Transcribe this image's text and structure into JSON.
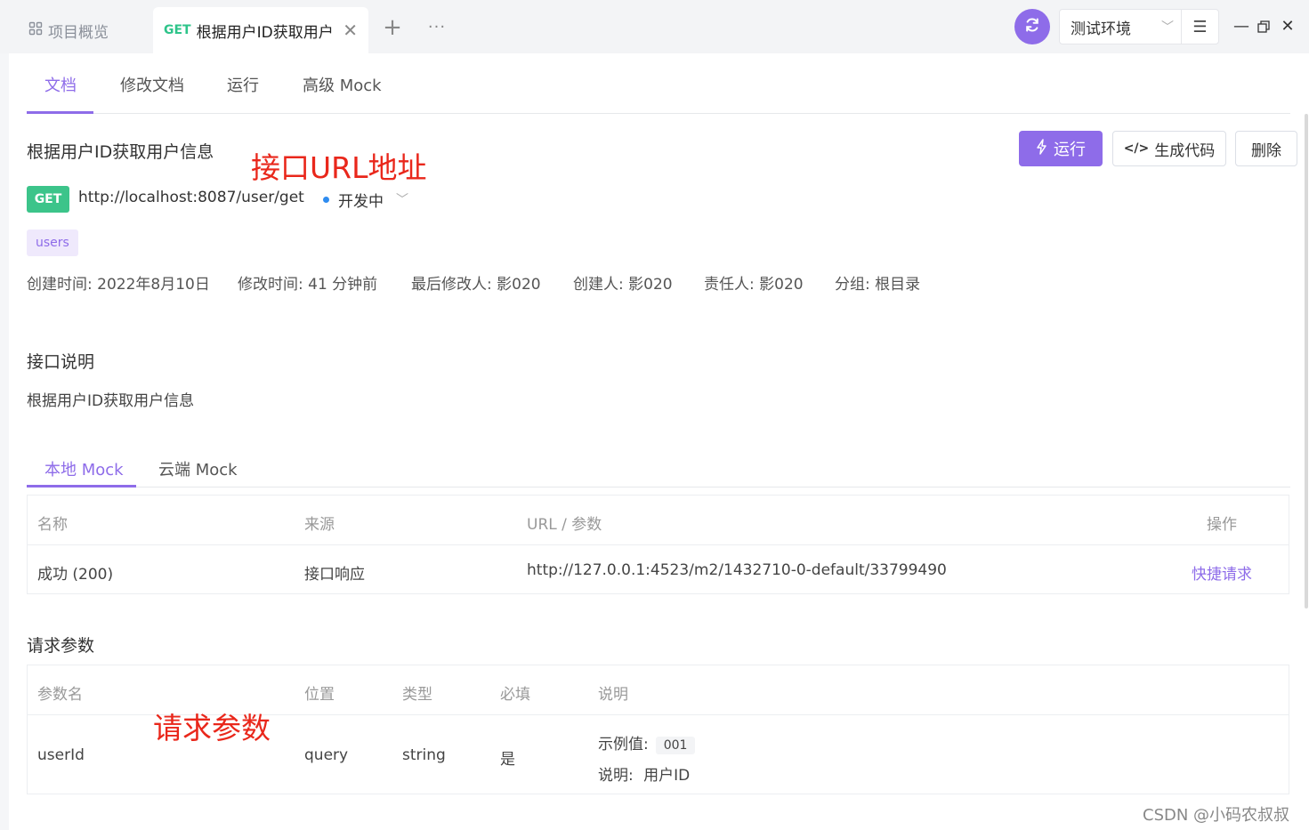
{
  "top_tabs": {
    "overview_label": "项目概览",
    "active_method": "GET",
    "active_label": "根据用户ID获取用户",
    "plus": "+",
    "more": "···"
  },
  "env": {
    "label": "测试环境"
  },
  "sub_tabs": [
    "文档",
    "修改文档",
    "运行",
    "高级 Mock"
  ],
  "api": {
    "title": "根据用户ID获取用户信息",
    "method": "GET",
    "url": "http://localhost:8087/user/get",
    "status": "开发中",
    "tag": "users"
  },
  "actions": {
    "run": "运行",
    "gen_code": "生成代码",
    "delete": "删除"
  },
  "annotations": {
    "url": "接口URL地址",
    "params": "请求参数"
  },
  "meta": [
    "创建时间: 2022年8月10日",
    "修改时间: 41 分钟前",
    "最后修改人: 影020",
    "创建人: 影020",
    "责任人: 影020",
    "分组: 根目录"
  ],
  "description": {
    "title": "接口说明",
    "text": "根据用户ID获取用户信息"
  },
  "mock": {
    "tabs": [
      "本地 Mock",
      "云端 Mock"
    ],
    "headers": [
      "名称",
      "来源",
      "URL / 参数",
      "操作"
    ],
    "row": {
      "name": "成功 (200)",
      "source": "接口响应",
      "url": "http://127.0.0.1:4523/m2/1432710-0-default/33799490",
      "action": "快捷请求"
    }
  },
  "params": {
    "title": "请求参数",
    "headers": [
      "参数名",
      "位置",
      "类型",
      "必填",
      "说明"
    ],
    "row": {
      "name": "userId",
      "location": "query",
      "type": "string",
      "required": "是",
      "example_label": "示例值:",
      "example_value": "001",
      "desc_label": "说明:",
      "desc_value": "用户ID"
    }
  },
  "watermark": "CSDN @小码农叔叔",
  "colors": {
    "accent": "#8e6ce9",
    "get_green": "#3cc48a",
    "annotation_red": "#e9271b",
    "status_blue": "#2f8cf0"
  }
}
